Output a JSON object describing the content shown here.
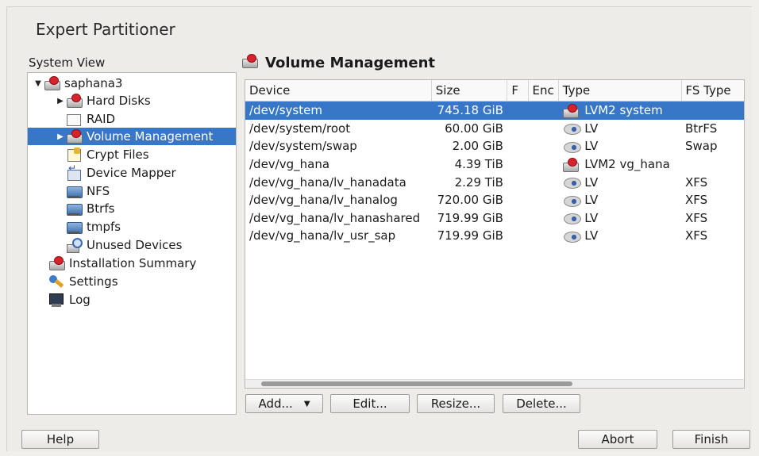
{
  "window": {
    "title": "Expert Partitioner"
  },
  "system_view": {
    "label": "System View",
    "tree": [
      {
        "label": "saphana3",
        "icon": "disk-icon",
        "expanded": true
      },
      {
        "label": "Hard Disks",
        "icon": "disk-icon",
        "arrow": "right"
      },
      {
        "label": "RAID",
        "icon": "raid-icon"
      },
      {
        "label": "Volume Management",
        "icon": "disk-icon",
        "arrow": "right",
        "selected": true
      },
      {
        "label": "Crypt Files",
        "icon": "crypt-icon"
      },
      {
        "label": "Device Mapper",
        "icon": "mapper-icon"
      },
      {
        "label": "NFS",
        "icon": "folder-icon"
      },
      {
        "label": "Btrfs",
        "icon": "folder-icon"
      },
      {
        "label": "tmpfs",
        "icon": "folder-icon"
      },
      {
        "label": "Unused Devices",
        "icon": "unused-icon"
      },
      {
        "label": "Installation Summary",
        "icon": "disk-icon"
      },
      {
        "label": "Settings",
        "icon": "settings-icon"
      },
      {
        "label": "Log",
        "icon": "log-icon"
      }
    ]
  },
  "volume_management": {
    "title": "Volume Management",
    "columns": [
      "Device",
      "Size",
      "F",
      "Enc",
      "Type",
      "FS Type"
    ],
    "rows": [
      {
        "device": "/dev/system",
        "size": "745.18 GiB",
        "f": "",
        "enc": "",
        "type": "LVM2 system",
        "type_icon": "vg-icon",
        "fs": "",
        "selected": true
      },
      {
        "device": "/dev/system/root",
        "size": "60.00 GiB",
        "f": "",
        "enc": "",
        "type": "LV",
        "type_icon": "lv-icon",
        "fs": "BtrFS"
      },
      {
        "device": "/dev/system/swap",
        "size": "2.00 GiB",
        "f": "",
        "enc": "",
        "type": "LV",
        "type_icon": "lv-icon",
        "fs": "Swap"
      },
      {
        "device": "/dev/vg_hana",
        "size": "4.39 TiB",
        "f": "",
        "enc": "",
        "type": "LVM2 vg_hana",
        "type_icon": "vg-icon",
        "fs": ""
      },
      {
        "device": "/dev/vg_hana/lv_hanadata",
        "size": "2.29 TiB",
        "f": "",
        "enc": "",
        "type": "LV",
        "type_icon": "lv-icon",
        "fs": "XFS"
      },
      {
        "device": "/dev/vg_hana/lv_hanalog",
        "size": "720.00 GiB",
        "f": "",
        "enc": "",
        "type": "LV",
        "type_icon": "lv-icon",
        "fs": "XFS"
      },
      {
        "device": "/dev/vg_hana/lv_hanashared",
        "size": "719.99 GiB",
        "f": "",
        "enc": "",
        "type": "LV",
        "type_icon": "lv-icon",
        "fs": "XFS"
      },
      {
        "device": "/dev/vg_hana/lv_usr_sap",
        "size": "719.99 GiB",
        "f": "",
        "enc": "",
        "type": "LV",
        "type_icon": "lv-icon",
        "fs": "XFS"
      }
    ],
    "buttons": {
      "add": "Add...",
      "edit": "Edit...",
      "resize": "Resize...",
      "delete": "Delete..."
    }
  },
  "footer": {
    "help": "Help",
    "abort": "Abort",
    "finish": "Finish"
  },
  "colors": {
    "selection": "#3877c8",
    "background": "#edece9"
  }
}
